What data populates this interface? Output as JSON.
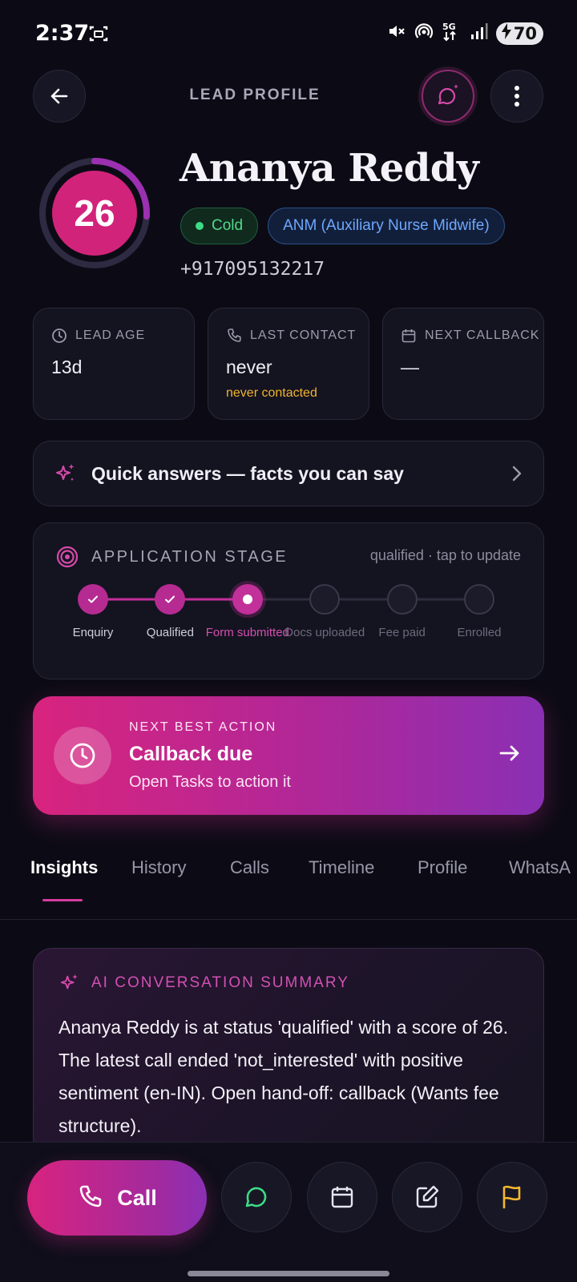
{
  "status_bar": {
    "time": "2:37",
    "battery": "70"
  },
  "header": {
    "title": "LEAD PROFILE"
  },
  "lead": {
    "score": "26",
    "score_progress": 0.26,
    "name": "Ananya Reddy",
    "status_tag": "Cold",
    "course_tag": "ANM (Auxiliary Nurse Midwife)",
    "phone": "+917095132217"
  },
  "stats": [
    {
      "label": "LEAD AGE",
      "value": "13d",
      "sub": ""
    },
    {
      "label": "LAST CONTACT",
      "value": "never",
      "sub": "never contacted"
    },
    {
      "label": "NEXT CALLBACK",
      "value": "—",
      "sub": ""
    }
  ],
  "quick_answers": {
    "label": "Quick answers — facts you can say"
  },
  "application_stage": {
    "title": "APPLICATION STAGE",
    "status": "qualified · tap to update",
    "steps": [
      {
        "label": "Enquiry",
        "state": "done"
      },
      {
        "label": "Qualified",
        "state": "done"
      },
      {
        "label": "Form submitted",
        "state": "current"
      },
      {
        "label": "Docs uploaded",
        "state": "pending"
      },
      {
        "label": "Fee paid",
        "state": "pending"
      },
      {
        "label": "Enrolled",
        "state": "pending"
      }
    ]
  },
  "next_best_action": {
    "kicker": "NEXT BEST ACTION",
    "title": "Callback due",
    "subtitle": "Open Tasks to action it"
  },
  "tabs": [
    "Insights",
    "History",
    "Calls",
    "Timeline",
    "Profile",
    "WhatsA"
  ],
  "active_tab": "Insights",
  "ai_summary": {
    "title": "AI CONVERSATION SUMMARY",
    "text": "Ananya Reddy is at status 'qualified' with a score of 26. The latest call ended 'not_interested' with positive sentiment (en-IN). Open hand-off: callback (Wants fee structure)."
  },
  "bottom_bar": {
    "call_label": "Call"
  },
  "colors": {
    "accent": "#d8247e",
    "accent_purple": "#8a30b4",
    "cold_green": "#3ddc84",
    "course_blue": "#6fa7ff",
    "warning": "#f1b42f",
    "flag": "#f5b82e",
    "whatsapp": "#3ddc84"
  }
}
